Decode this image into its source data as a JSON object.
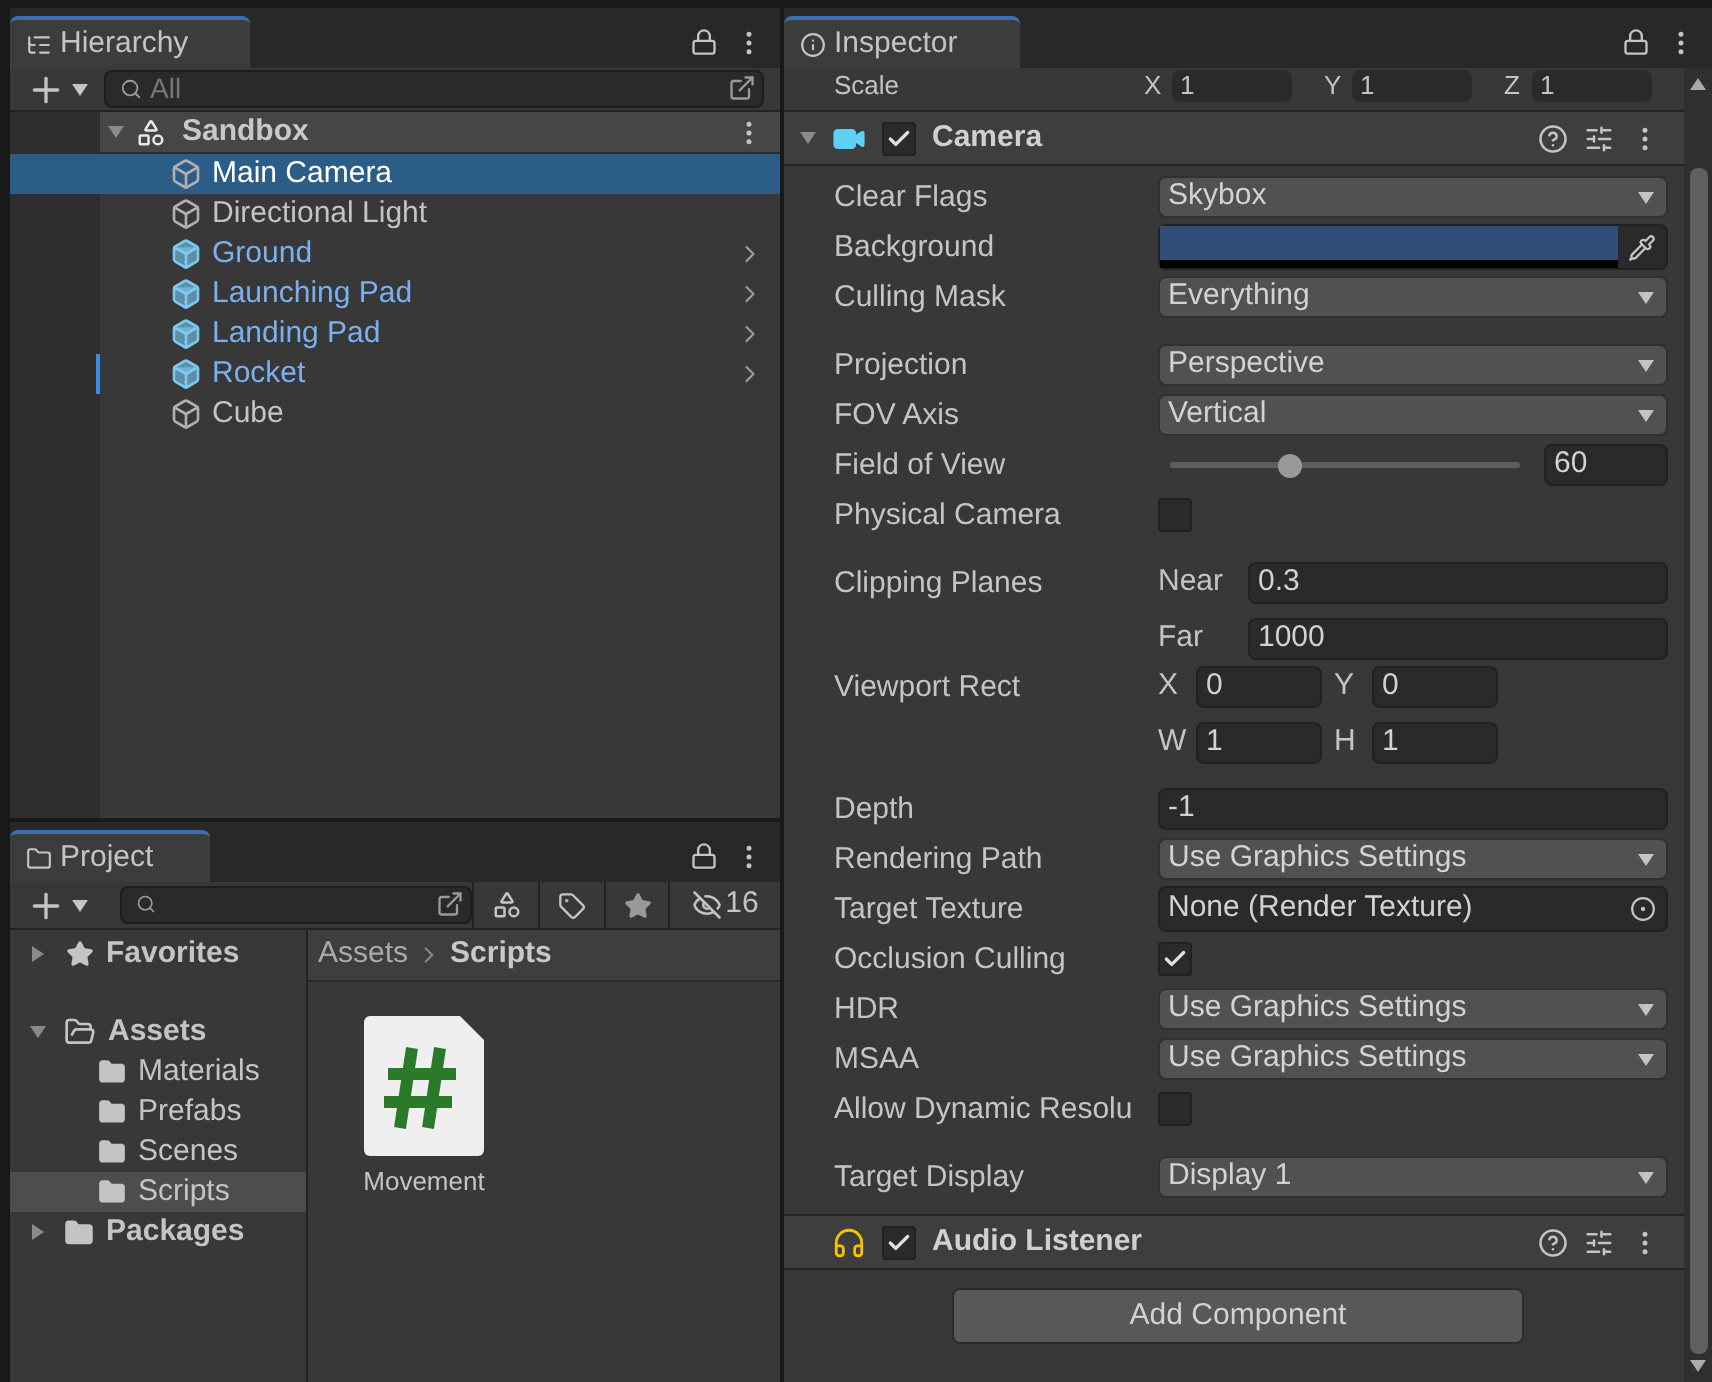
{
  "hierarchy": {
    "title": "Hierarchy",
    "search": {
      "placeholder": "All"
    },
    "scene": {
      "name": "Sandbox",
      "expanded": true
    },
    "items": [
      {
        "name": "Main Camera",
        "kind": "object",
        "selected": true,
        "marked": false
      },
      {
        "name": "Directional Light",
        "kind": "object",
        "selected": false,
        "marked": false
      },
      {
        "name": "Ground",
        "kind": "prefab",
        "selected": false,
        "marked": false
      },
      {
        "name": "Launching Pad",
        "kind": "prefab",
        "selected": false,
        "marked": false
      },
      {
        "name": "Landing Pad",
        "kind": "prefab",
        "selected": false,
        "marked": false
      },
      {
        "name": "Rocket",
        "kind": "prefab",
        "selected": false,
        "marked": true
      },
      {
        "name": "Cube",
        "kind": "object",
        "selected": false,
        "marked": false
      }
    ]
  },
  "project": {
    "title": "Project",
    "hidden_count": "16",
    "tree": [
      {
        "label": "Favorites",
        "kind": "favorites",
        "expanded": false,
        "selected": false
      },
      {
        "label": "Assets",
        "kind": "folder",
        "expanded": true,
        "selected": false,
        "children": [
          {
            "label": "Materials",
            "selected": false
          },
          {
            "label": "Prefabs",
            "selected": false
          },
          {
            "label": "Scenes",
            "selected": false
          },
          {
            "label": "Scripts",
            "selected": true
          }
        ]
      },
      {
        "label": "Packages",
        "kind": "folder",
        "expanded": false,
        "selected": false
      }
    ],
    "breadcrumb": [
      "Assets",
      "Scripts"
    ],
    "files": [
      {
        "name": "Movement",
        "kind": "script"
      }
    ]
  },
  "inspector": {
    "title": "Inspector",
    "scale_row": {
      "label": "Scale",
      "fields": [
        {
          "axis": "X",
          "value": "1"
        },
        {
          "axis": "Y",
          "value": "1"
        },
        {
          "axis": "Z",
          "value": "1"
        }
      ]
    },
    "components": [
      {
        "name": "Camera",
        "kind": "camera",
        "enabled": true,
        "expanded": true,
        "properties": [
          {
            "label": "Clear Flags",
            "kind": "dropdown",
            "value": "Skybox"
          },
          {
            "label": "Background",
            "kind": "color",
            "color": "#314d79"
          },
          {
            "label": "Culling Mask",
            "kind": "dropdown",
            "value": "Everything"
          },
          {
            "label": "Projection",
            "kind": "dropdown",
            "value": "Perspective",
            "gap_before": true
          },
          {
            "label": "FOV Axis",
            "kind": "dropdown",
            "value": "Vertical"
          },
          {
            "label": "Field of View",
            "kind": "slider",
            "level": 0.34,
            "value": "60"
          },
          {
            "label": "Physical Camera",
            "kind": "checkbox",
            "checked": false
          },
          {
            "label": "Clipping Planes",
            "kind": "planes",
            "gap_before": true,
            "fields": [
              {
                "label": "Near",
                "value": "0.3"
              },
              {
                "label": "Far",
                "value": "1000"
              }
            ]
          },
          {
            "label": "Viewport Rect",
            "kind": "rect",
            "fields": [
              {
                "label": "X",
                "value": "0"
              },
              {
                "label": "Y",
                "value": "0"
              },
              {
                "label": "W",
                "value": "1"
              },
              {
                "label": "H",
                "value": "1"
              }
            ]
          },
          {
            "label": "Depth",
            "kind": "number",
            "value": "-1",
            "gap_before": true
          },
          {
            "label": "Rendering Path",
            "kind": "dropdown",
            "value": "Use Graphics Settings"
          },
          {
            "label": "Target Texture",
            "kind": "object",
            "value": "None (Render Texture)"
          },
          {
            "label": "Occlusion Culling",
            "kind": "checkbox",
            "checked": true
          },
          {
            "label": "HDR",
            "kind": "dropdown",
            "value": "Use Graphics Settings"
          },
          {
            "label": "MSAA",
            "kind": "dropdown",
            "value": "Use Graphics Settings"
          },
          {
            "label": "Allow Dynamic Resolu",
            "kind": "checkbox",
            "checked": false
          },
          {
            "label": "Target Display",
            "kind": "dropdown",
            "value": "Display 1",
            "gap_before": true
          }
        ]
      },
      {
        "name": "Audio Listener",
        "kind": "audio",
        "enabled": true,
        "expanded": false
      }
    ],
    "add_button": "Add Component"
  }
}
